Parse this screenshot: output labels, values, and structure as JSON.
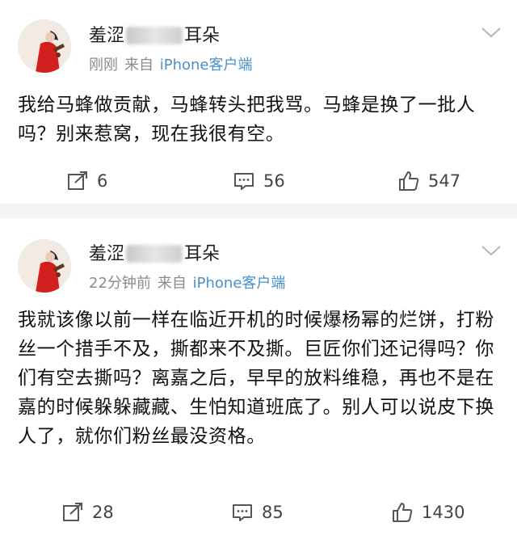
{
  "posts": [
    {
      "username_prefix": "羞涩",
      "username_suffix": "耳朵",
      "time": "刚刚",
      "source_label": "来自",
      "device": "iPhone客户端",
      "content": "我给马蜂做贡献，马蜂转头把我骂。马蜂是换了一批人吗？别来惹窝，现在我很有空。",
      "reposts": "6",
      "comments": "56",
      "likes": "547",
      "icons": [
        "avatar",
        "chevron-down-icon",
        "repost-icon",
        "comment-icon",
        "like-icon"
      ]
    },
    {
      "username_prefix": "羞涩",
      "username_suffix": "耳朵",
      "time": "22分钟前",
      "source_label": "来自",
      "device": "iPhone客户端",
      "content": "我就该像以前一样在临近开机的时候爆杨幂的烂饼，打粉丝一个措手不及，撕都来不及撕。巨匠你们还记得吗？你们有空去撕吗？离嘉之后，早早的放料维稳，再也不是在嘉的时候躲躲藏藏、生怕知道班底了。别人可以说皮下换人了，就你们粉丝最没资格。",
      "reposts": "28",
      "comments": "85",
      "likes": "1430",
      "icons": [
        "avatar",
        "chevron-down-icon",
        "repost-icon",
        "comment-icon",
        "like-icon"
      ]
    }
  ],
  "colors": {
    "link": "#4a90c8",
    "meta": "#8a8a8a",
    "separator": "#f3f3f3"
  }
}
